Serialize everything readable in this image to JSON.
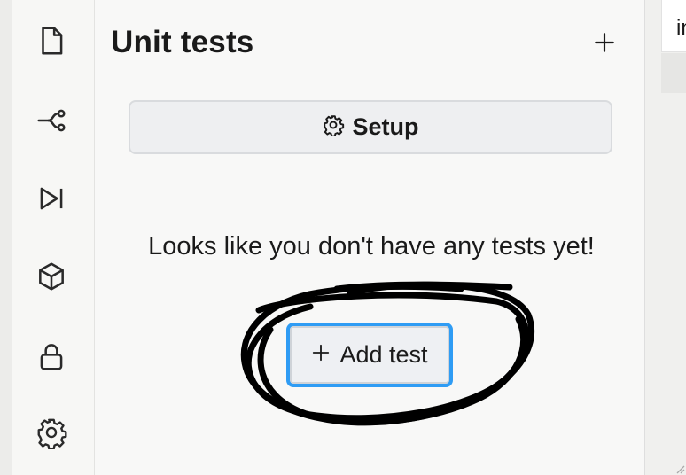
{
  "rail": {
    "icons": [
      "file-icon",
      "branch-icon",
      "play-skip-icon",
      "cube-icon",
      "lock-icon",
      "gear-icon"
    ]
  },
  "panel": {
    "title": "Unit tests",
    "add_symbol": "+",
    "setup_button_label": "Setup",
    "empty_message": "Looks like you don't have any tests yet!",
    "add_test_button_label": "Add test",
    "add_test_symbol": "+"
  },
  "right_pane": {
    "visible_text": "in"
  },
  "colors": {
    "accent_focus": "#2f9cf4",
    "scribble": "#000000",
    "text": "#1a1a1a"
  }
}
